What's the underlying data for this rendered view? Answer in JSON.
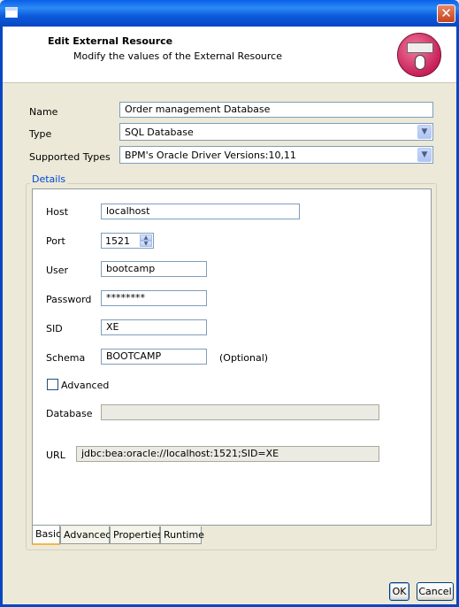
{
  "window": {
    "close_glyph": "✕"
  },
  "header": {
    "title": "Edit External Resource",
    "subtitle": "Modify the values of the External Resource",
    "icon": "keyboard-mouse-icon"
  },
  "form": {
    "name_label": "Name",
    "name_value": "Order management Database",
    "type_label": "Type",
    "type_value": "SQL Database",
    "supported_types_label": "Supported Types",
    "supported_types_value": "BPM's Oracle Driver Versions:10,11"
  },
  "details": {
    "legend": "Details",
    "host_label": "Host",
    "host_value": "localhost",
    "port_label": "Port",
    "port_value": "1521",
    "user_label": "User",
    "user_value": "bootcamp",
    "password_label": "Password",
    "password_value": "********",
    "sid_label": "SID",
    "sid_value": "XE",
    "schema_label": "Schema",
    "schema_value": "BOOTCAMP",
    "schema_hint": "(Optional)",
    "advanced_label": "Advanced",
    "advanced_checked": false,
    "database_label": "Database",
    "database_value": "",
    "url_label": "URL",
    "url_value": "jdbc:bea:oracle://localhost:1521;SID=XE"
  },
  "tabs": [
    {
      "label": "Basic",
      "active": true
    },
    {
      "label": "Advanced",
      "active": false
    },
    {
      "label": "Properties",
      "active": false
    },
    {
      "label": "Runtime",
      "active": false
    }
  ],
  "buttons": {
    "ok": "OK",
    "cancel": "Cancel"
  },
  "colors": {
    "titlebar": "#0b5bdc",
    "dialog_bg": "#ece9d8",
    "legend_text": "#0046d5"
  }
}
